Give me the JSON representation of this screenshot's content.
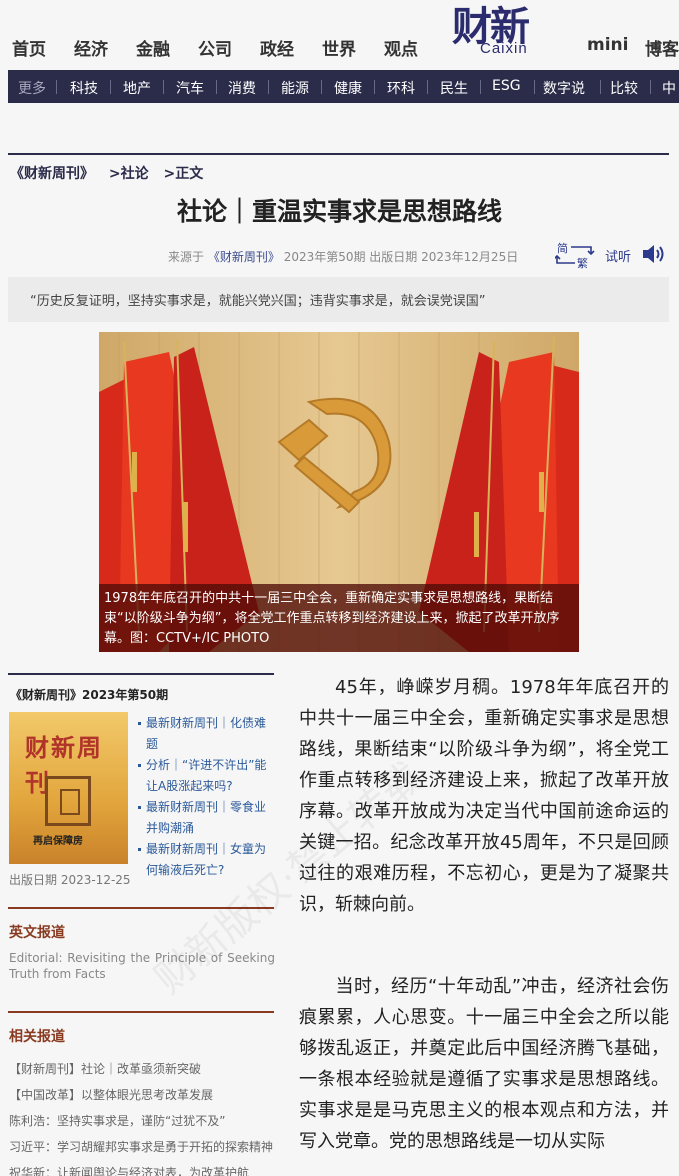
{
  "header": {
    "nav": [
      "首页",
      "经济",
      "金融",
      "公司",
      "政经",
      "世界",
      "观点"
    ],
    "logo_main": "财新",
    "logo_sub": "Caixin",
    "nav_right": [
      "mini",
      "博客"
    ]
  },
  "subnav": {
    "more": "更多",
    "items": [
      "科技",
      "地产",
      "汽车",
      "消费",
      "能源",
      "健康",
      "环科",
      "民生",
      "ESG",
      "数字说",
      "比较",
      "中"
    ]
  },
  "breadcrumb": [
    "《财新周刊》",
    ">社论",
    ">正文"
  ],
  "article": {
    "title": "社论｜重温实事求是思想路线",
    "meta_prefix": "来源于",
    "source": "《财新周刊》",
    "meta_issue": "2023年第50期 出版日期 2023年12月25日",
    "listen": "试听",
    "simp_trad_icon": "simplified-traditional-icon",
    "speaker_icon": "speaker-icon",
    "quote": "“历史反复证明，坚持实事求是，就能兴党兴国；违背实事求是，就会误党误国”",
    "image_caption": "1978年年底召开的中共十一届三中全会，重新确定实事求是思想路线，果断结束“以阶级斗争为纲”，将全党工作重点转移到经济建设上来，掀起了改革开放序幕。图：CCTV+/IC PHOTO",
    "paragraphs": [
      "45年，峥嵘岁月稠。1978年年底召开的中共十一届三中全会，重新确定实事求是思想路线，果断结束“以阶级斗争为纲”，将全党工作重点转移到经济建设上来，掀起了改革开放序幕。改革开放成为决定当代中国前途命运的关键一招。纪念改革开放45周年，不只是回顾过往的艰难历程，不忘初心，更是为了凝聚共识，斩棘向前。",
      "当时，经历“十年动乱”冲击，经济社会伤痕累累，人心思变。十一届三中全会之所以能够拨乱返正，并奠定此后中国经济腾飞基础，一条根本经验就是遵循了实事求是思想路线。实事求是是马克思主义的根本观点和方法，并写入党章。党的思想路线是一切从实际"
    ]
  },
  "sidebar": {
    "issue_title": "《财新周刊》2023年第50期",
    "cover_title": "财新周刊",
    "cover_band": "再启保障房",
    "issue_date": "出版日期 2023-12-25",
    "issue_links": [
      "最新财新周刊｜化债难题",
      "分析｜“许进不许出”能让A股涨起来吗?",
      "最新财新周刊｜零食业并购潮涌",
      "最新财新周刊｜女童为何输液后死亡?"
    ],
    "english_head": "英文报道",
    "english_link": "Editorial: Revisiting the Principle of Seeking Truth from Facts",
    "related_head": "相关报道",
    "related": [
      "【财新周刊】社论｜改革亟须新突破",
      "【中国改革】以整体眼光思考改革发展",
      "陈利浩：坚持实事求是，谨防“过犹不及”",
      "习近平：学习胡耀邦实事求是勇于开拓的探索精神",
      "祝华新：让新闻舆论与经济对表，为改革护航"
    ]
  },
  "watermark": "财新版权·禁止转载"
}
